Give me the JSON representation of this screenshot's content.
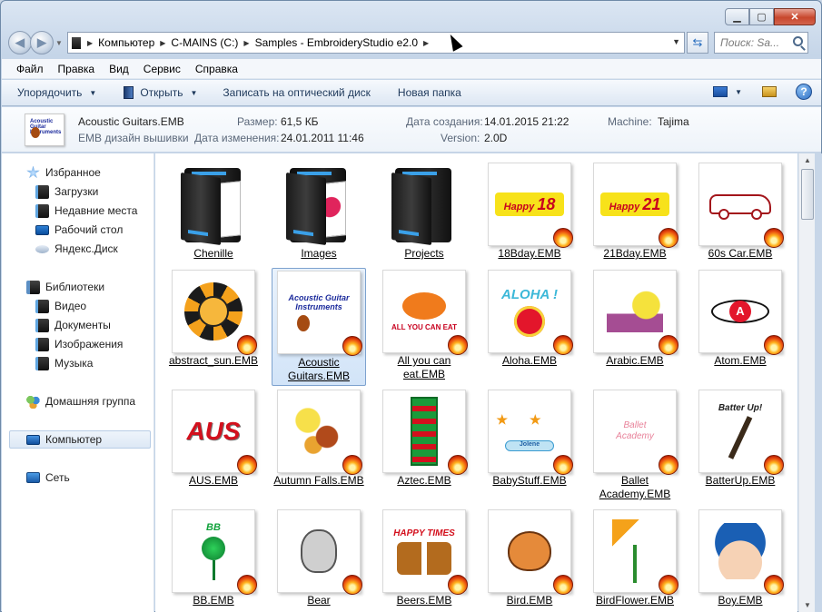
{
  "window": {
    "caption_buttons": [
      "minimize",
      "maximize",
      "close"
    ]
  },
  "address_bar": {
    "crumbs": [
      "Компьютер",
      "C-MAINS (C:)",
      "Samples - EmbroideryStudio e2.0"
    ],
    "search_placeholder": "Поиск: Sa..."
  },
  "menubar": {
    "items": [
      "Файл",
      "Правка",
      "Вид",
      "Сервис",
      "Справка"
    ]
  },
  "commandbar": {
    "organize": "Упорядочить",
    "open": "Открыть",
    "burn": "Записать на оптический диск",
    "new_folder": "Новая папка"
  },
  "details": {
    "filename": "Acoustic Guitars.EMB",
    "filetype": "EMB дизайн вышивки",
    "size_label": "Размер:",
    "size_value": "61,5 КБ",
    "modified_label": "Дата изменения:",
    "modified_value": "24.01.2011 11:46",
    "created_label": "Дата создания:",
    "created_value": "14.01.2015 21:22",
    "version_label": "Version:",
    "version_value": "2.0D",
    "machine_label": "Machine:",
    "machine_value": "Tajima"
  },
  "sidebar": {
    "favorites": "Избранное",
    "downloads": "Загрузки",
    "recent": "Недавние места",
    "desktop": "Рабочий стол",
    "yadisk": "Яндекс.Диск",
    "libraries": "Библиотеки",
    "video": "Видео",
    "documents": "Документы",
    "images": "Изображения",
    "music": "Музыка",
    "homegroup": "Домашняя группа",
    "computer": "Компьютер",
    "network": "Сеть"
  },
  "files": [
    {
      "name": "Chenille",
      "kind": "folder"
    },
    {
      "name": "Images",
      "kind": "folder"
    },
    {
      "name": "Projects",
      "kind": "folder"
    },
    {
      "name": "18Bday.EMB",
      "kind": "emb",
      "art": "Happy 18"
    },
    {
      "name": "21Bday.EMB",
      "kind": "emb",
      "art": "Happy 21"
    },
    {
      "name": "60s Car.EMB",
      "kind": "emb",
      "art": "car"
    },
    {
      "name": "abstract_sun.EMB",
      "kind": "emb",
      "art": "sun"
    },
    {
      "name": "Acoustic Guitars.EMB",
      "kind": "emb",
      "art": "Acoustic Guitar Instruments",
      "selected": true
    },
    {
      "name": "All you can eat.EMB",
      "kind": "emb",
      "art": "ALL YOU CAN EAT"
    },
    {
      "name": "Aloha.EMB",
      "kind": "emb",
      "art": "ALOHA !"
    },
    {
      "name": "Arabic.EMB",
      "kind": "emb",
      "art": "houses"
    },
    {
      "name": "Atom.EMB",
      "kind": "emb",
      "art": "A"
    },
    {
      "name": "AUS.EMB",
      "kind": "emb",
      "art": "AUS"
    },
    {
      "name": "Autumn Falls.EMB",
      "kind": "emb",
      "art": "leaves"
    },
    {
      "name": "Aztec.EMB",
      "kind": "emb",
      "art": "aztec"
    },
    {
      "name": "BabyStuff.EMB",
      "kind": "emb",
      "art": "Jolene"
    },
    {
      "name": "Ballet Academy.EMB",
      "kind": "emb",
      "art": "Ballet Academy"
    },
    {
      "name": "BatterUp.EMB",
      "kind": "emb",
      "art": "Batter Up!"
    },
    {
      "name": "BB.EMB",
      "kind": "emb",
      "art": "BB"
    },
    {
      "name": "Bear",
      "kind": "emb",
      "art": "bear"
    },
    {
      "name": "Beers.EMB",
      "kind": "emb",
      "art": "HAPPY TIMES"
    },
    {
      "name": "Bird.EMB",
      "kind": "emb",
      "art": "bird"
    },
    {
      "name": "BirdFlower.EMB",
      "kind": "emb",
      "art": "bird of paradise"
    },
    {
      "name": "Boy.EMB",
      "kind": "emb",
      "art": "boy"
    }
  ],
  "colors": {
    "accent": "#3a7bd5",
    "selection": "#d2e4f8",
    "fire": "#e84a0f"
  }
}
